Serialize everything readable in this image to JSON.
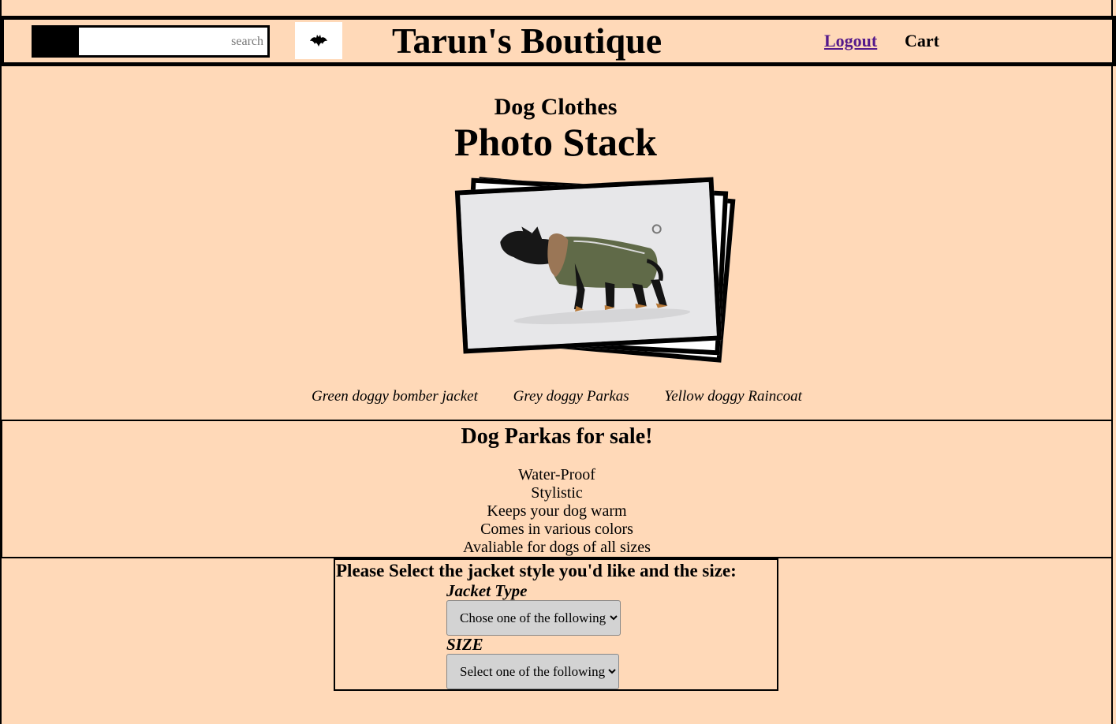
{
  "header": {
    "search_placeholder": "search",
    "title": "Tarun's Boutique",
    "logout_label": "Logout",
    "cart_label": "Cart",
    "logo_icon": "bat-icon"
  },
  "gallery": {
    "category": "Dog Clothes",
    "title": "Photo Stack",
    "captions": [
      "Green doggy bomber jacket",
      "Grey doggy Parkas",
      "Yellow doggy Raincoat"
    ],
    "image_icon": "dog-parka-photo"
  },
  "sale": {
    "title": "Dog Parkas for sale!",
    "features": [
      "Water-Proof",
      "Stylistic",
      "Keeps your dog warm",
      "Comes in various colors",
      "Avaliable for dogs of all sizes"
    ]
  },
  "selection": {
    "title": "Please Select the jacket style you'd like and the size:",
    "jacket_label": "Jacket Type",
    "jacket_selected": "Chose one of the following",
    "size_label": "SIZE",
    "size_selected": "Select one of the following"
  },
  "colors": {
    "background": "#ffd9b8",
    "border": "#000000",
    "link": "#551a8b"
  }
}
